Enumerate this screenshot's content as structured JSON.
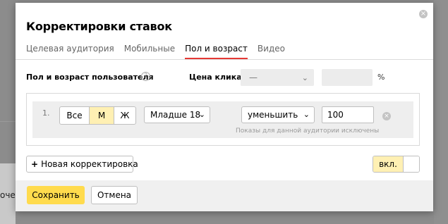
{
  "background": {
    "partial_text": "очe"
  },
  "dialog": {
    "title": "Корректировки ставок",
    "tabs": [
      {
        "label": "Целевая аудитория",
        "active": false
      },
      {
        "label": "Мобильные",
        "active": false
      },
      {
        "label": "Пол и возраст",
        "active": true
      },
      {
        "label": "Видео",
        "active": false
      }
    ],
    "fields": {
      "audience_label": "Пол и возраст пользователя",
      "price_label": "Цена клика",
      "price_select_value": "—",
      "percent_sign": "%"
    },
    "rows": [
      {
        "number": "1.",
        "gender_options": [
          "Все",
          "М",
          "Ж"
        ],
        "gender_selected": "М",
        "age_value": "Младше 18",
        "mode_value": "уменьшить",
        "amount_value": "100",
        "hint": "Показы для данной аудитории исключены"
      }
    ],
    "new_button_label": "Новая корректировка",
    "toggle_label": "вкл.",
    "save_label": "Сохранить",
    "cancel_label": "Отмена"
  },
  "colors": {
    "accent": "#ffdb4d",
    "selected": "#fff0b3",
    "active_tab_underline": "#e53935"
  }
}
